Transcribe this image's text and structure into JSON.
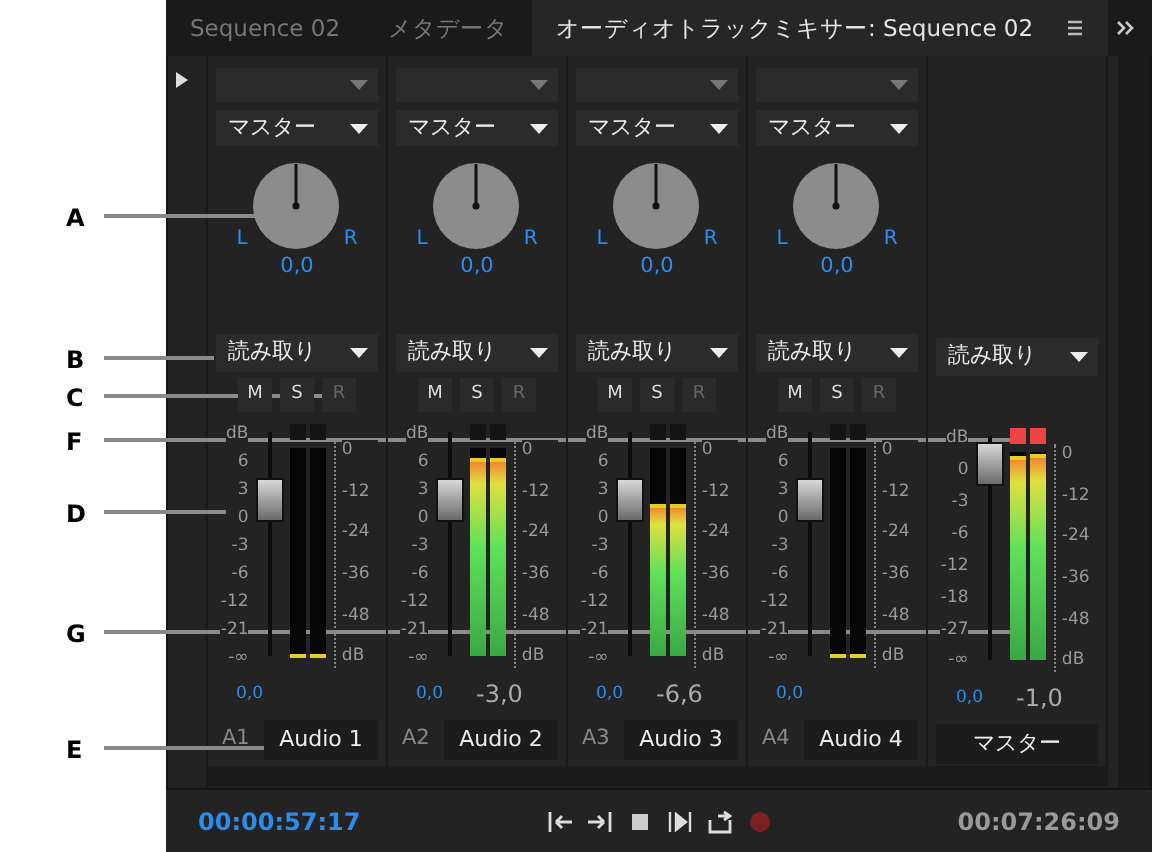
{
  "callouts": [
    {
      "letter": "A"
    },
    {
      "letter": "B"
    },
    {
      "letter": "C"
    },
    {
      "letter": "F"
    },
    {
      "letter": "D"
    },
    {
      "letter": "G"
    },
    {
      "letter": "E"
    }
  ],
  "tabs": [
    {
      "label": "Sequence 02",
      "selected": false
    },
    {
      "label": "メタデータ",
      "selected": false
    },
    {
      "label": "オーディオトラックミキサー: Sequence 02",
      "selected": true
    }
  ],
  "channels": [
    {
      "kind": "track",
      "send": "マスター",
      "pan": {
        "left": "L",
        "right": "R",
        "value": "0,0"
      },
      "automation": "読み取り",
      "buttons": [
        {
          "label": "M",
          "disabled": false
        },
        {
          "label": "S",
          "disabled": false
        },
        {
          "label": "R",
          "disabled": true
        }
      ],
      "fader_scale": [
        "dB",
        "6",
        "3",
        "0",
        "-3",
        "-6",
        "-12",
        "-21",
        "-∞"
      ],
      "fader_level": {
        "level": 0.72
      },
      "clip": false,
      "meters": [
        {
          "level": 0
        },
        {
          "level": 0
        }
      ],
      "meter_scale": [
        "0",
        "-12",
        "-24",
        "-36",
        "-48",
        "dB"
      ],
      "volume": "0,0",
      "track_id": "A1",
      "name": "Audio 1"
    },
    {
      "kind": "track",
      "send": "マスター",
      "pan": {
        "left": "L",
        "right": "R",
        "value": "0,0"
      },
      "automation": "読み取り",
      "buttons": [
        {
          "label": "M",
          "disabled": false
        },
        {
          "label": "S",
          "disabled": false
        },
        {
          "label": "R",
          "disabled": true
        }
      ],
      "fader_scale": [
        "dB",
        "6",
        "3",
        "0",
        "-3",
        "-6",
        "-12",
        "-21",
        "-∞"
      ],
      "fader_level": {
        "level": 0.72
      },
      "clip": false,
      "meters": [
        {
          "level": 0.94
        },
        {
          "level": 0.94
        }
      ],
      "meter_scale": [
        "0",
        "-12",
        "-24",
        "-36",
        "-48",
        "dB"
      ],
      "volume": "0,0",
      "reading": "-3,0",
      "track_id": "A2",
      "name": "Audio 2"
    },
    {
      "kind": "track",
      "send": "マスター",
      "pan": {
        "left": "L",
        "right": "R",
        "value": "0,0"
      },
      "automation": "読み取り",
      "buttons": [
        {
          "label": "M",
          "disabled": false
        },
        {
          "label": "S",
          "disabled": false
        },
        {
          "label": "R",
          "disabled": true
        }
      ],
      "fader_scale": [
        "dB",
        "6",
        "3",
        "0",
        "-3",
        "-6",
        "-12",
        "-21",
        "-∞"
      ],
      "fader_level": {
        "level": 0.72
      },
      "clip": false,
      "meters": [
        {
          "level": 0.72
        },
        {
          "level": 0.72
        }
      ],
      "meter_scale": [
        "0",
        "-12",
        "-24",
        "-36",
        "-48",
        "dB"
      ],
      "volume": "0,0",
      "reading": "-6,6",
      "track_id": "A3",
      "name": "Audio 3"
    },
    {
      "kind": "track",
      "send": "マスター",
      "pan": {
        "left": "L",
        "right": "R",
        "value": "0,0"
      },
      "automation": "読み取り",
      "buttons": [
        {
          "label": "M",
          "disabled": false
        },
        {
          "label": "S",
          "disabled": false
        },
        {
          "label": "R",
          "disabled": true
        }
      ],
      "fader_scale": [
        "dB",
        "6",
        "3",
        "0",
        "-3",
        "-6",
        "-12",
        "-21",
        "-∞"
      ],
      "fader_level": {
        "level": 0.72
      },
      "clip": false,
      "meters": [
        {
          "level": 0
        },
        {
          "level": 0
        }
      ],
      "meter_scale": [
        "0",
        "-12",
        "-24",
        "-36",
        "-48",
        "dB"
      ],
      "volume": "0,0",
      "track_id": "A4",
      "name": "Audio 4"
    },
    {
      "kind": "master",
      "automation": "読み取り",
      "fader_scale": [
        "dB",
        "0",
        "-3",
        "-6",
        "-12",
        "-18",
        "-27",
        "-∞"
      ],
      "fader_level": {
        "level": 0.93
      },
      "clip": true,
      "meters": [
        {
          "level": 0.97
        },
        {
          "level": 0.98
        }
      ],
      "meter_scale": [
        "0",
        "-12",
        "-24",
        "-36",
        "-48",
        "dB"
      ],
      "volume": "0,0",
      "reading": "-1,0",
      "name": "マスター"
    }
  ],
  "footer": {
    "timecode": "00:00:57:17",
    "duration": "00:07:26:09"
  }
}
